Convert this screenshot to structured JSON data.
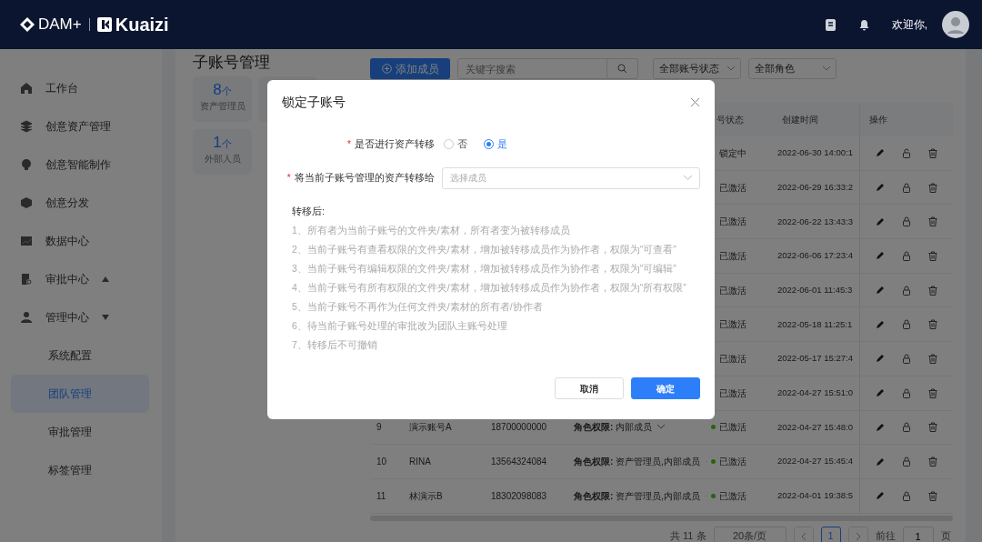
{
  "header": {
    "logo": "DAM+",
    "brand": "Kuaizi",
    "greeting": "欢迎你,"
  },
  "sidebar": {
    "items": [
      {
        "label": "工作台",
        "selected": false
      },
      {
        "label": "创意资产管理",
        "selected": false
      },
      {
        "label": "创意智能制作",
        "selected": false
      },
      {
        "label": "创意分发",
        "selected": false
      },
      {
        "label": "数据中心",
        "selected": false
      },
      {
        "label": "审批中心",
        "selected": false,
        "expanded": false
      },
      {
        "label": "管理中心",
        "selected": false,
        "expanded": true,
        "children": [
          {
            "label": "系统配置",
            "selected": false
          },
          {
            "label": "团队管理",
            "selected": true
          },
          {
            "label": "审批管理",
            "selected": false
          },
          {
            "label": "标签管理",
            "selected": false
          }
        ]
      }
    ]
  },
  "page_title": "子账号管理",
  "stats": [
    {
      "count": "8",
      "unit": "个",
      "label": "资产管理员"
    },
    {
      "kind": "hidden"
    },
    {
      "count": "1",
      "unit": "个",
      "label": "外部人员"
    }
  ],
  "toolbar": {
    "add_button": "添加成员",
    "search": {
      "placeholder": "关键字搜索"
    },
    "filters": [
      "全部账号状态",
      "全部角色"
    ]
  },
  "table": {
    "columns": [
      "号状态",
      "创建时间",
      "操作"
    ],
    "rows": [
      {
        "status": "锁定中",
        "created": "2022-06-30 14:00:1",
        "locked": true
      },
      {
        "status": "已激活",
        "created": "2022-06-29 16:33:2",
        "locked": false
      },
      {
        "status": "已激活",
        "created": "2022-06-22 13:43:3",
        "locked": false
      },
      {
        "status": "已激活",
        "created": "2022-06-06 17:23:4",
        "locked": false
      },
      {
        "status": "已激活",
        "created": "2022-06-01 11:45:3",
        "locked": false
      },
      {
        "status": "已激活",
        "created": "2022-05-18 11:25:1",
        "locked": false
      },
      {
        "status": "已激活",
        "created": "2022-05-17 15:27:4",
        "locked": false
      },
      {
        "status": "已激活",
        "created": "2022-04-27 15:51:0",
        "locked": false
      },
      {
        "index": "9",
        "name": "演示账号A",
        "phone": "18700000000",
        "role": "**角色权限:** 内部成员",
        "status": "已激活",
        "color": "#29620d",
        "created": "2022-04-27 15:48:0",
        "locked": false
      },
      {
        "index": "10",
        "name": "RINA",
        "phone": "13564324084",
        "role": "**角色权限:** 资产管理员,内部成员",
        "status": "已激活",
        "color": "#29620d",
        "created": "2022-04-27 15:45:4",
        "locked": false
      },
      {
        "index": "11",
        "name": "林演示B",
        "phone": "18302098083",
        "role": "**角色权限:** 资产管理员,内部成员",
        "status": "已激活",
        "color": "#29620d",
        "created": "2022-04-01 19:38:5",
        "locked": false
      }
    ]
  },
  "pagination": {
    "total": "共 11 条",
    "page_size": "20条/页",
    "pages": [
      {
        "label": "1",
        "selected": true
      }
    ],
    "goto_label": "前往",
    "goto_value": "1",
    "goto_suffix": "页"
  },
  "modal": {
    "title": "锁定子账号",
    "transfer_required": "*",
    "transfer_label": "是否进行资产转移",
    "transfer_options": [
      {
        "label": "否",
        "selected": false
      },
      {
        "label": "是",
        "selected": true
      }
    ],
    "target_required": "*",
    "target_label": "将当前子账号管理的资产转移给",
    "target": {
      "placeholder": "选择成员"
    },
    "notes_title": "转移后:",
    "notes": [
      "1、所有者为当前子账号的文件夹/素材，所有者变为被转移成员",
      "2、当前子账号有查看权限的文件夹/素材，增加被转移成员作为协作者，权限为“可查看”",
      "3、当前子账号有编辑权限的文件夹/素材，增加被转移成员作为协作者，权限为“可编辑”",
      "4、当前子账号有所有权限的文件夹/素材，增加被转移成员作为协作者，权限为“所有权限”",
      "5、当前子账号不再作为任何文件夹/素材的所有者/协作者",
      "6、待当前子账号处理的审批改为团队主账号处理",
      "7、转移后不可撤销"
    ],
    "buttons": [
      {
        "label": "取消",
        "kind": "secondary"
      },
      {
        "label": "确定",
        "kind": "primary"
      }
    ]
  }
}
